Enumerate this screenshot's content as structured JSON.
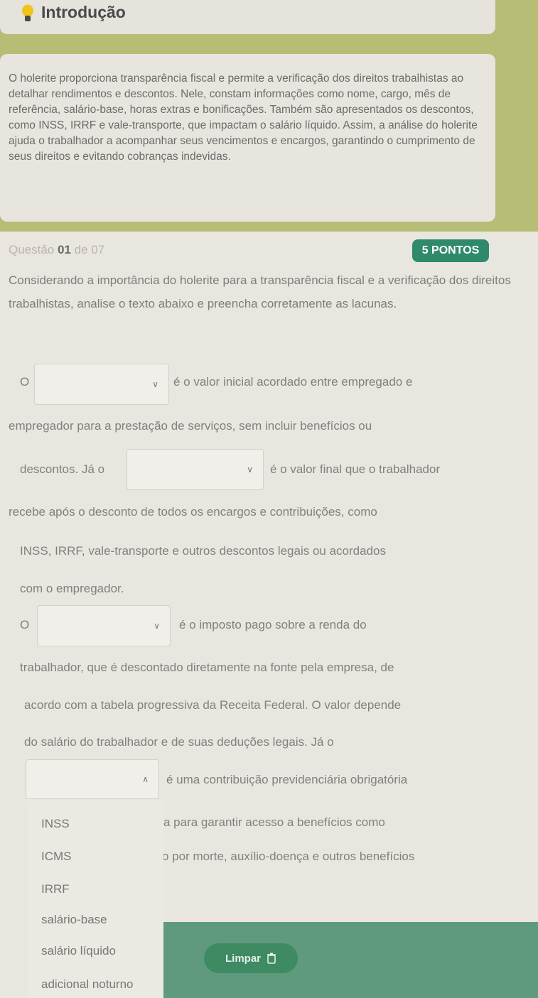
{
  "intro": {
    "title": "Introdução",
    "text": "O holerite proporciona transparência fiscal e permite a verificação dos direitos trabalhistas ao detalhar rendimentos e descontos. Nele, constam informações como nome, cargo, mês de referência, salário-base, horas extras e bonificações. Também são apresentados os descontos, como INSS, IRRF e vale-transporte, que impactam o salário líquido. Assim, a análise do holerite ajuda o trabalhador a acompanhar seus vencimentos e encargos, garantindo o cumprimento de seus direitos e evitando cobranças indevidas."
  },
  "question": {
    "label_prefix": "Questão ",
    "number": "01",
    "label_suffix": " de 07",
    "points": "5 PONTOS",
    "prompt": "Considerando a importância do holerite para a transparência fiscal e a verificação dos direitos trabalhistas, analise o texto abaixo e preencha corretamente as lacunas."
  },
  "passage": {
    "l1_a": "O",
    "l1_b": "é o valor inicial acordado entre empregado e",
    "l2": "empregador para a prestação de serviços, sem incluir benefícios ou",
    "l3_a": "descontos. Já o",
    "l3_b": "é o valor final que o trabalhador",
    "l4": "recebe após o desconto de todos os encargos e contribuições, como",
    "l5": "INSS, IRRF, vale-transporte e outros descontos legais ou acordados",
    "l6": "com o empregador.",
    "l7_a": "O",
    "l7_b": "é o imposto pago sobre a renda do",
    "l8": "trabalhador, que é descontado diretamente na fonte pela empresa, de",
    "l9": "acordo com a tabela progressiva da Receita Federal. O valor depende",
    "l10": "do salário do trabalhador e de suas deduções legais. Já o",
    "l11": "é uma contribuição previdenciária obrigatória",
    "l12": "a para garantir acesso a benefícios como",
    "l13": "o por morte, auxílio-doença e outros benefícios"
  },
  "dropdown_options": [
    "INSS",
    "ICMS",
    "IRRF",
    "salário-base",
    "salário líquido",
    "adicional noturno"
  ],
  "clear_button": "Limpar"
}
